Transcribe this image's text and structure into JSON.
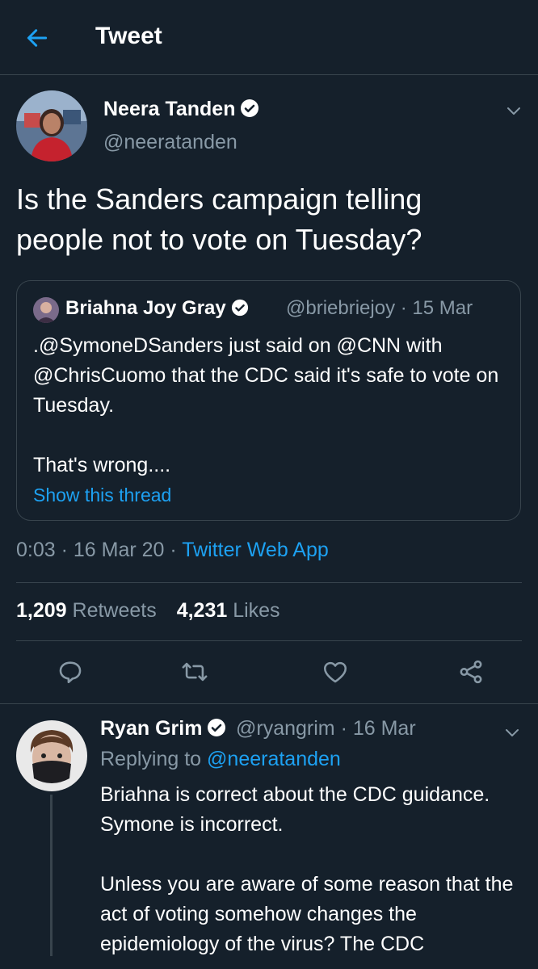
{
  "header": {
    "title": "Tweet"
  },
  "tweet": {
    "name": "Neera Tanden",
    "handle": "@neeratanden",
    "text": "Is the Sanders campaign telling people not to vote on Tuesday?",
    "quote": {
      "name": "Briahna Joy Gray",
      "handle": "@briebriejoy · 15 Mar",
      "text": ".@SymoneDSanders just said on @CNN with @ChrisCuomo that the CDC said it's safe to vote on Tuesday.\n\nThat's wrong....",
      "link": "Show this thread"
    },
    "time": "0:03 · 16 Mar 20 · ",
    "app": "Twitter Web App",
    "retweets_count": "1,209",
    "retweets_label": " Retweets",
    "likes_count": "4,231",
    "likes_label": " Likes"
  },
  "reply": {
    "name": "Ryan Grim",
    "handle": "@ryangrim · 16 Mar",
    "replying_prefix": "Replying to ",
    "replying_to": "@neeratanden",
    "text": "Briahna is correct about the CDC guidance. Symone is incorrect.\n\nUnless you are aware of some reason that the act of voting somehow changes the epidemiology of the virus? The CDC"
  },
  "colors": {
    "background": "#15202b",
    "accent": "#1da1f2",
    "muted": "#8899a6",
    "border": "#38444d"
  },
  "icons": [
    "back-arrow-icon",
    "verified-badge-icon",
    "chevron-down-icon",
    "reply-icon",
    "retweet-icon",
    "like-icon",
    "share-icon"
  ]
}
